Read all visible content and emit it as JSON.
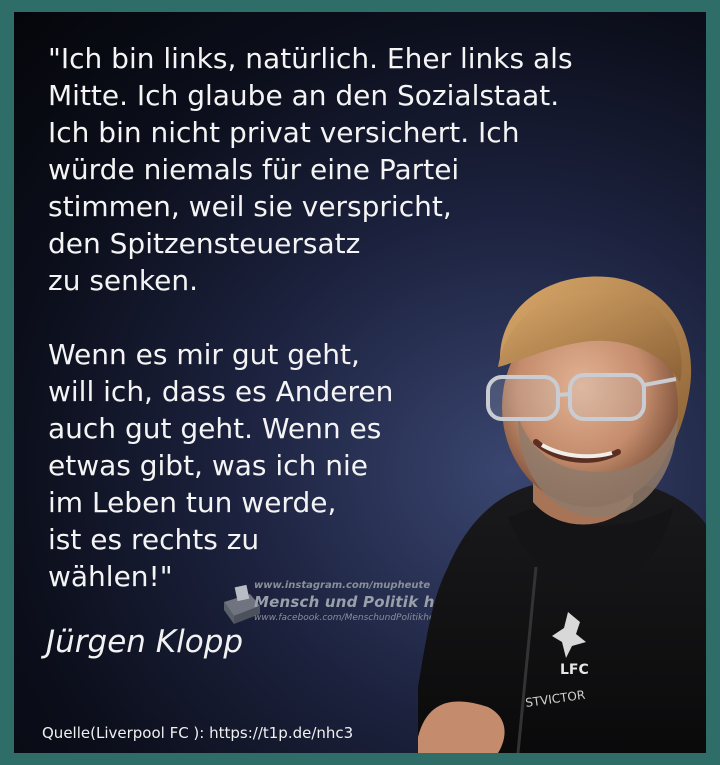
{
  "quote": {
    "paragraph1": "\"Ich bin links, natürlich. Eher links als\nMitte. Ich glaube an den Sozialstaat.\nIch bin nicht privat versichert. Ich\nwürde niemals für eine Partei\nstimmen, weil sie verspricht,\nden Spitzensteuersatz\nzu senken.",
    "paragraph2": "Wenn es mir gut geht,\nwill ich, dass es Anderen\nauch gut geht. Wenn es\netwas gibt, was ich nie\nim Leben tun werde,\nist es rechts zu\nwählen!\""
  },
  "author": "Jürgen Klopp",
  "watermark": {
    "line1": "www.instagram.com/mupheute",
    "line2": "Mensch und Politik heute",
    "line3": "www.facebook.com/MenschundPolitikheute"
  },
  "source": "Quelle(Liverpool FC ): https://t1p.de/nhc3",
  "photo": {
    "jacket_text": "STVICTOR",
    "crest_text": "LFC"
  },
  "colors": {
    "frame": "#2f6d68",
    "text": "#f4f4f4"
  }
}
